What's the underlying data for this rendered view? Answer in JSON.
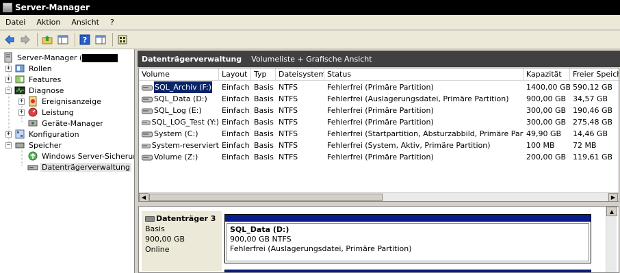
{
  "window": {
    "title": "Server-Manager"
  },
  "menu": [
    "Datei",
    "Aktion",
    "Ansicht",
    "?"
  ],
  "toolbar": [
    {
      "icon": "back-arrow-icon"
    },
    {
      "icon": "forward-arrow-icon"
    },
    {
      "icon": "up-folder-icon"
    },
    {
      "icon": "show-hide-tree-icon"
    },
    {
      "icon": "help-icon"
    },
    {
      "icon": "properties-icon"
    },
    {
      "icon": "settings-icon"
    }
  ],
  "tree": {
    "root": {
      "label": "Server-Manager (",
      "icon": "server-manager-icon"
    },
    "items": [
      {
        "label": "Rollen",
        "icon": "roles-icon",
        "expander": "+"
      },
      {
        "label": "Features",
        "icon": "features-icon",
        "expander": "+"
      },
      {
        "label": "Diagnose",
        "icon": "diagnose-icon",
        "expander": "−"
      },
      {
        "label": "Ereignisanzeige",
        "icon": "event-viewer-icon",
        "expander": "+"
      },
      {
        "label": "Leistung",
        "icon": "performance-icon",
        "expander": "+"
      },
      {
        "label": "Geräte-Manager",
        "icon": "device-manager-icon",
        "expander": ""
      },
      {
        "label": "Konfiguration",
        "icon": "configuration-icon",
        "expander": "+"
      },
      {
        "label": "Speicher",
        "icon": "storage-icon",
        "expander": "−"
      },
      {
        "label": "Windows Server-Sicherung",
        "icon": "backup-icon",
        "expander": ""
      },
      {
        "label": "Datenträgerverwaltung",
        "icon": "disk-management-icon",
        "expander": ""
      }
    ]
  },
  "header": {
    "title": "Datenträgerverwaltung",
    "subtitle": "Volumeliste + Grafische Ansicht"
  },
  "columns": [
    "Volume",
    "Layout",
    "Typ",
    "Dateisystem",
    "Status",
    "Kapazität",
    "Freier Speich"
  ],
  "volumes": [
    [
      "SQL_Archiv (F:)",
      "Einfach",
      "Basis",
      "NTFS",
      "Fehlerfrei (Primäre Partition)",
      "1400,00 GB",
      "590,12 GB"
    ],
    [
      "SQL_Data (D:)",
      "Einfach",
      "Basis",
      "NTFS",
      "Fehlerfrei (Auslagerungsdatei, Primäre Partition)",
      "900,00 GB",
      "34,57 GB"
    ],
    [
      "SQL_Log (E:)",
      "Einfach",
      "Basis",
      "NTFS",
      "Fehlerfrei (Primäre Partition)",
      "300,00 GB",
      "190,46 GB"
    ],
    [
      "SQL_LOG_Test (Y:)",
      "Einfach",
      "Basis",
      "NTFS",
      "Fehlerfrei (Primäre Partition)",
      "300,00 GB",
      "275,48 GB"
    ],
    [
      "System (C:)",
      "Einfach",
      "Basis",
      "NTFS",
      "Fehlerfrei (Startpartition, Absturzabbild, Primäre Partition)",
      "49,90 GB",
      "14,46 GB"
    ],
    [
      "System-reserviert",
      "Einfach",
      "Basis",
      "NTFS",
      "Fehlerfrei (System, Aktiv, Primäre Partition)",
      "100 MB",
      "72 MB"
    ],
    [
      "Volume (Z:)",
      "Einfach",
      "Basis",
      "NTFS",
      "Fehlerfrei (Primäre Partition)",
      "200,00 GB",
      "119,61 GB"
    ]
  ],
  "selected_volume": 0,
  "disk": {
    "title": "Datenträger 3",
    "type": "Basis",
    "size": "900,00 GB",
    "state": "Online",
    "partition": {
      "name": "SQL_Data  (D:)",
      "size_fs": "900,00 GB NTFS",
      "status": "Fehlerfrei (Auslagerungsdatei, Primäre Partition)"
    }
  },
  "colors": {
    "partition_bar": "#0a1c8c",
    "header_bg": "#404040",
    "selection": "#0a246a"
  }
}
